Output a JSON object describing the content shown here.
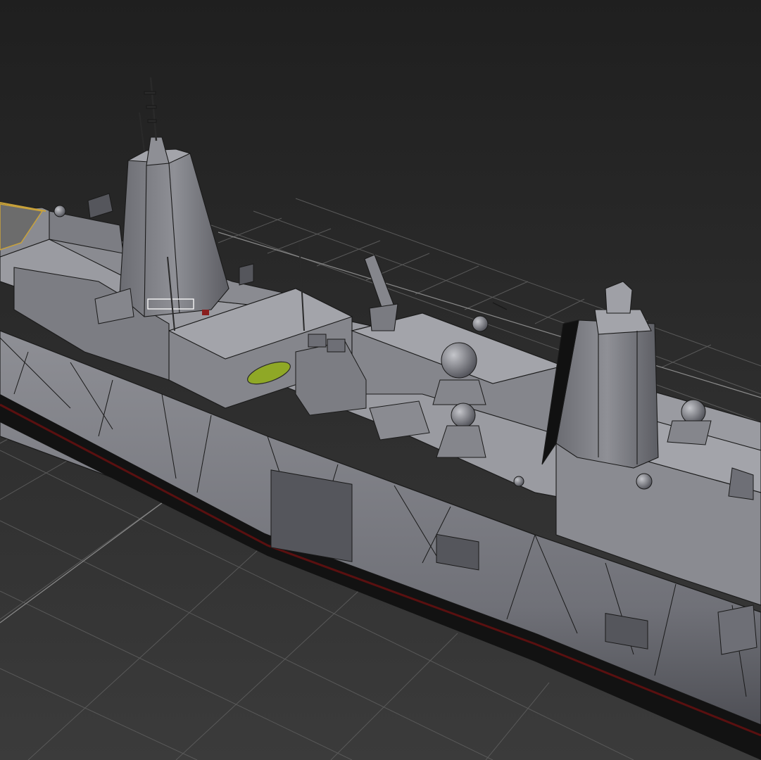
{
  "viewport": {
    "name": "3d-viewport",
    "background_top": "#1f1f1f",
    "background_bottom": "#3b3b3b"
  },
  "grid": {
    "visible": true,
    "line_color": "#5a5a5a",
    "light_line_color": "#8a8a8a"
  },
  "model": {
    "object": "naval-amphibious-transport-ship",
    "view": "perspective",
    "display_mode": "shaded-with-edged-faces",
    "colors": {
      "hull_light": "#8c8d93",
      "hull_mid": "#6e6f76",
      "hull_dark": "#4a4b52",
      "deck": "#9a9ba1",
      "waterline": "#111111",
      "boot_topping": "#5a1010",
      "mast": "#7d7e85",
      "wire_edges": "#1a1a1a",
      "selection_highlight": "#ffffff",
      "lifeboat": "#8fa826",
      "helipad": "#6c6c6c",
      "deck_edge_stripe": "#c9a23a"
    }
  }
}
